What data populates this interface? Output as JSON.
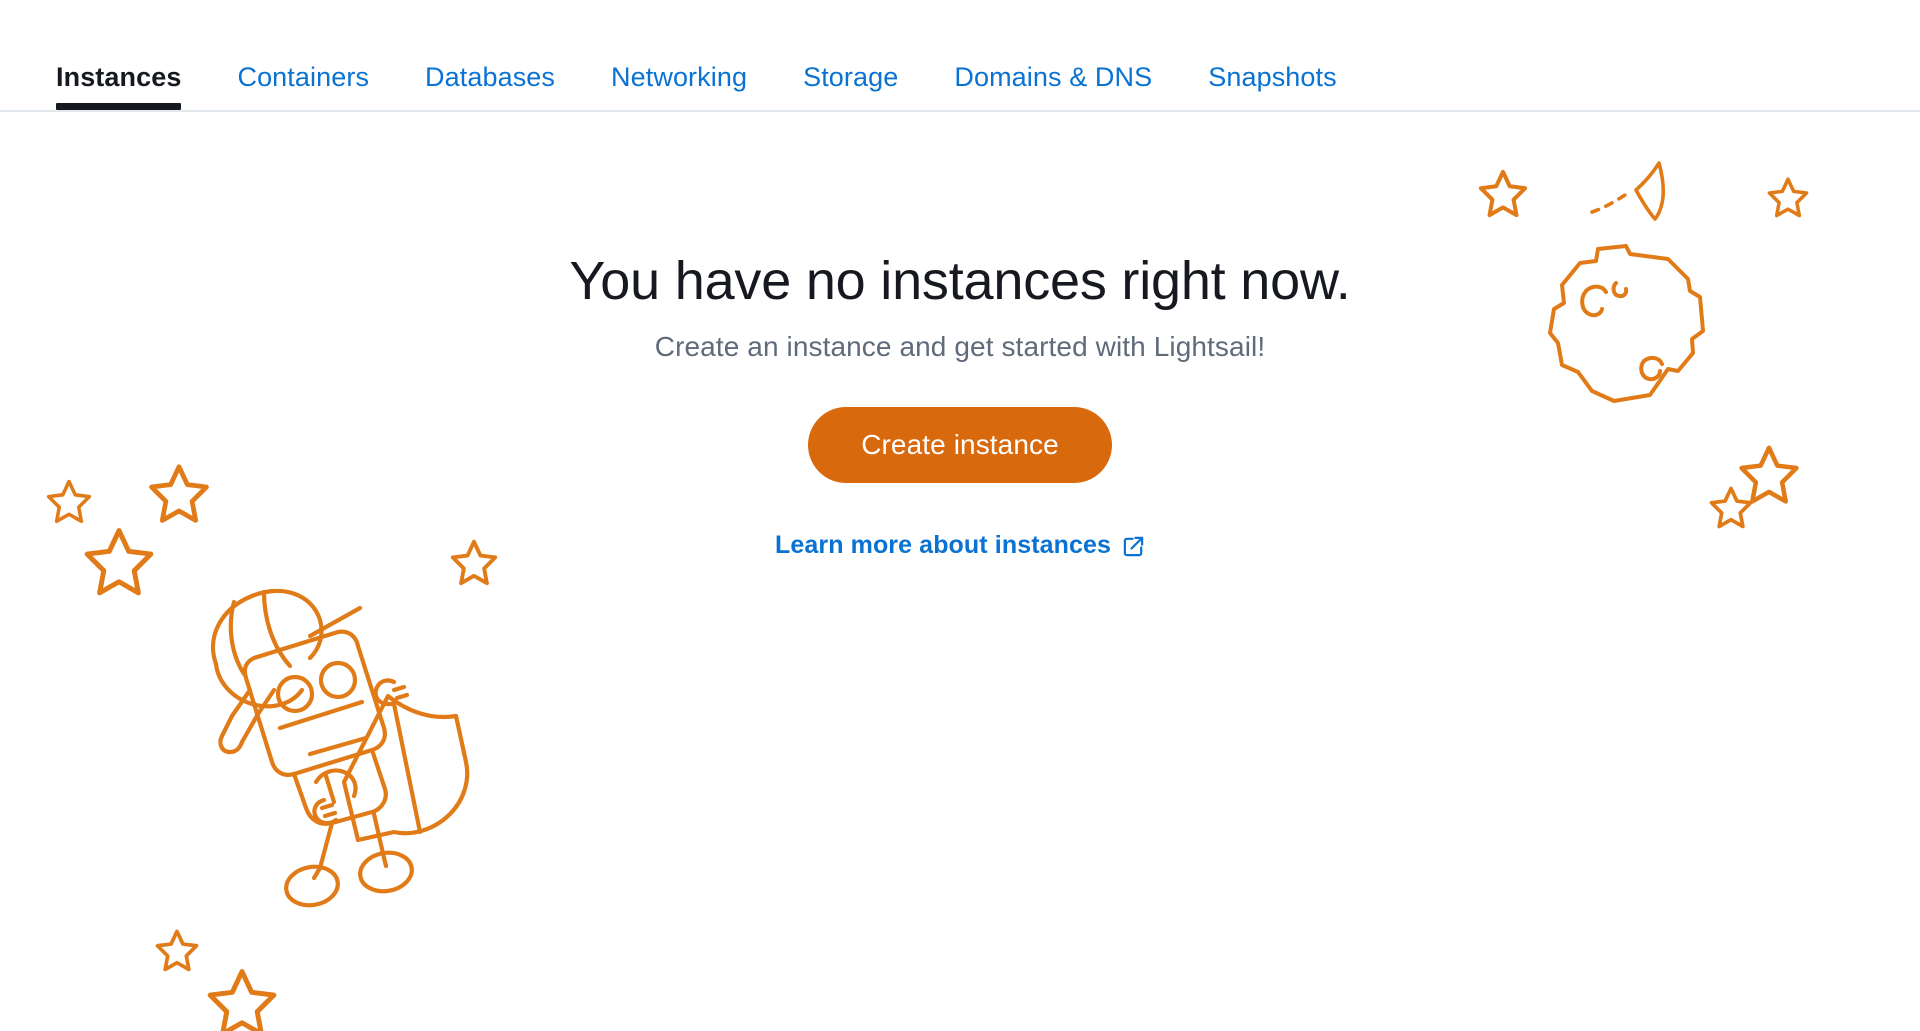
{
  "tabs": [
    {
      "label": "Instances",
      "active": true
    },
    {
      "label": "Containers",
      "active": false
    },
    {
      "label": "Databases",
      "active": false
    },
    {
      "label": "Networking",
      "active": false
    },
    {
      "label": "Storage",
      "active": false
    },
    {
      "label": "Domains & DNS",
      "active": false
    },
    {
      "label": "Snapshots",
      "active": false
    }
  ],
  "empty_state": {
    "title": "You have no instances right now.",
    "subtitle": "Create an instance and get started with Lightsail!",
    "create_button_label": "Create instance",
    "learn_more_label": "Learn more about instances",
    "learn_more_icon": "external-link-icon"
  },
  "illustration": {
    "robot": "astronaut-robot-with-flag",
    "planet": "planet-with-craters",
    "rocket": "rocket-with-dashed-trail",
    "stars_count": 10
  },
  "colors": {
    "accent_orange": "#d9690d",
    "link_blue": "#0972d3",
    "text_dark": "#16191f",
    "text_muted": "#5f6b7a",
    "border": "#e3e8ee",
    "background": "#ffffff"
  }
}
